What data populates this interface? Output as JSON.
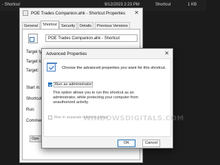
{
  "background": {
    "left_text": "- Shortcut",
    "date_text": "9/12/2023 2:23 PM",
    "type_text": "Shortcut",
    "size_text": "1 KB"
  },
  "props_window": {
    "title": "POE Trades Companion.ahk - Shortcut Properties",
    "tabs": [
      "General",
      "Shortcut",
      "Security",
      "Details",
      "Previous Versions"
    ],
    "active_tab": "Shortcut",
    "shortcut_name": "POE Trades Companion.ahk - Shortcut",
    "labels": {
      "target_type": "Target typ",
      "target_location": "Target loc",
      "target": "Target:",
      "start_in": "Start in:",
      "shortcut_key": "Shortcut k",
      "run": "Run:",
      "comment": "Comment:"
    },
    "open_label": "Ope"
  },
  "advanced_dialog": {
    "title": "Advanced Properties",
    "heading": "Choose the advanced properties you want for this shortcut.",
    "run_as_admin": {
      "label": "Run as administrator",
      "checked": true
    },
    "description_lines": [
      "This option allows you to run this shortcut as an",
      "administrator, while protecting your computer from",
      "unauthorized activity."
    ],
    "separate_memory": {
      "label": "Run in separate memory space",
      "checked": false,
      "enabled": false
    },
    "ok_label": "OK",
    "cancel_label": "Cancel"
  },
  "watermark": "WINDOWSDIGITALS.COM",
  "colors": {
    "accent": "#1f6fb5",
    "window_bg": "#f3f3f3",
    "desktop_bg": "#1b1b1b"
  }
}
